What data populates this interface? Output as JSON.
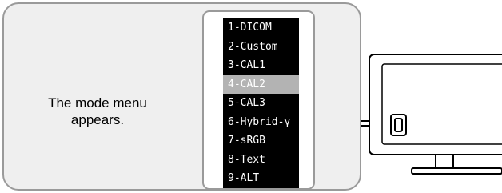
{
  "caption": {
    "line1": "The mode menu",
    "line2": "appears."
  },
  "mode_menu": {
    "items": [
      {
        "label": "1-DICOM",
        "selected": false
      },
      {
        "label": "2-Custom",
        "selected": false
      },
      {
        "label": "3-CAL1",
        "selected": false
      },
      {
        "label": "4-CAL2",
        "selected": true
      },
      {
        "label": "5-CAL3",
        "selected": false
      },
      {
        "label": "6-Hybrid-γ",
        "selected": false
      },
      {
        "label": "7-sRGB",
        "selected": false
      },
      {
        "label": "8-Text",
        "selected": false
      },
      {
        "label": "9-ALT",
        "selected": false
      }
    ]
  },
  "monitor": {
    "highlighted_control": "mode-button-icon"
  },
  "colors": {
    "panel_background": "#efefef",
    "panel_border": "#9a9a9a",
    "menu_background": "#000000",
    "menu_text": "#ffffff",
    "menu_selected": "#b3b3b3"
  }
}
